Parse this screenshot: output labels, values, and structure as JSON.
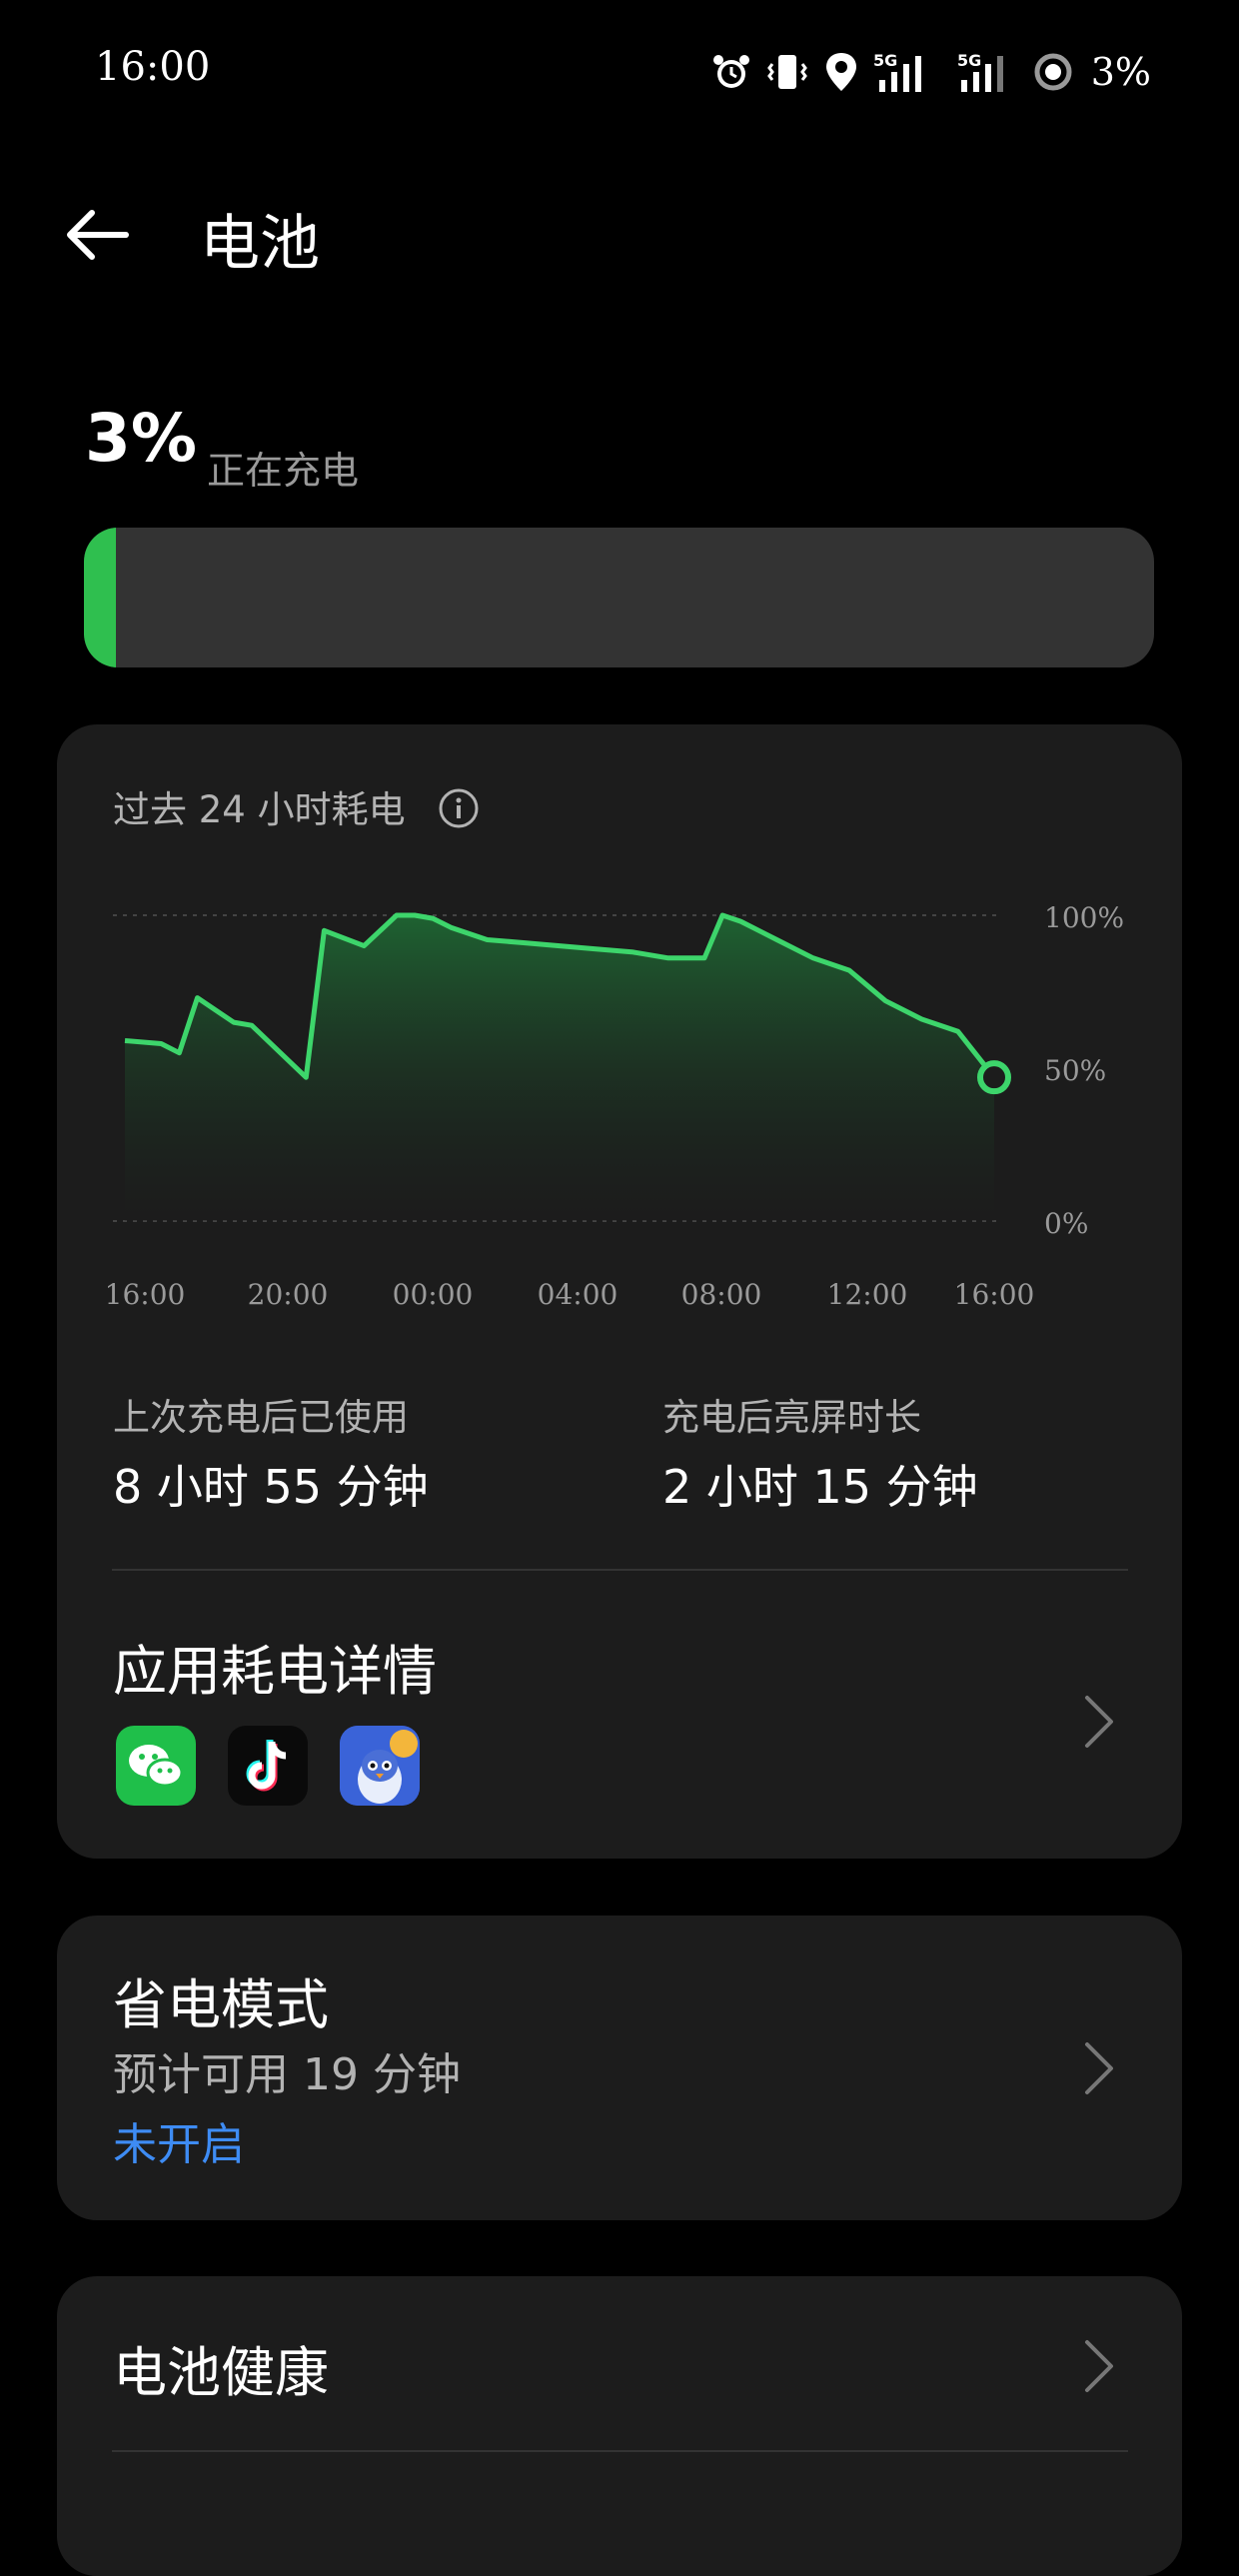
{
  "status_bar": {
    "time": "16:00",
    "battery_text": "3%",
    "icons": [
      "alarm-icon",
      "vibrate-icon",
      "location-icon",
      "5g-signal-icon",
      "5g-signal-icon",
      "battery-saver-ring-icon"
    ]
  },
  "header": {
    "back_icon": "arrow-left-icon",
    "title": "电池"
  },
  "battery": {
    "percent_text": "3%",
    "status": "正在充电",
    "level": 0.03,
    "bar_color": "#2fbf4f"
  },
  "usage_card": {
    "title": "过去 24 小时耗电",
    "info_icon": "info-icon",
    "chart_data": {
      "type": "area",
      "x_ticks": [
        "16:00",
        "20:00",
        "00:00",
        "04:00",
        "08:00",
        "12:00",
        "16:00"
      ],
      "y_ticks": [
        "100%",
        "50%",
        "0%"
      ],
      "ylim": [
        0,
        100
      ],
      "grid": "dashed at 0% and 100%",
      "series": [
        {
          "x_hours": [
            0,
            1,
            1.5,
            2,
            3,
            3.5,
            5,
            5.5,
            6.6,
            7.5,
            8,
            8.5,
            9,
            10,
            11,
            12,
            13,
            14,
            15,
            16,
            16.5,
            17,
            18,
            19,
            20,
            21,
            22,
            23,
            24
          ],
          "values": [
            59,
            58,
            55,
            73,
            65,
            64,
            47,
            95,
            90,
            100,
            100,
            99,
            96,
            92,
            91,
            90,
            89,
            88,
            86,
            86,
            100,
            98,
            92,
            86,
            82,
            72,
            66,
            62,
            47
          ]
        }
      ],
      "line_color": "#3dd56b",
      "current_value": 47
    },
    "stats": {
      "used_label": "上次充电后已使用",
      "used_value": "8 小时 55 分钟",
      "screen_label": "充电后亮屏时长",
      "screen_value": "2 小时 15 分钟"
    },
    "app_section": {
      "title": "应用耗电详情",
      "apps": [
        "wechat-icon",
        "tiktok-icon",
        "game-penguin-icon"
      ]
    }
  },
  "power_saving": {
    "title": "省电模式",
    "estimate": "预计可用 19 分钟",
    "state": "未开启"
  },
  "battery_health": {
    "title": "电池健康"
  },
  "colors": {
    "background": "#000000",
    "card": "#1c1c1c",
    "accent_green": "#2fbf4f",
    "link_blue": "#3e8cf4"
  }
}
